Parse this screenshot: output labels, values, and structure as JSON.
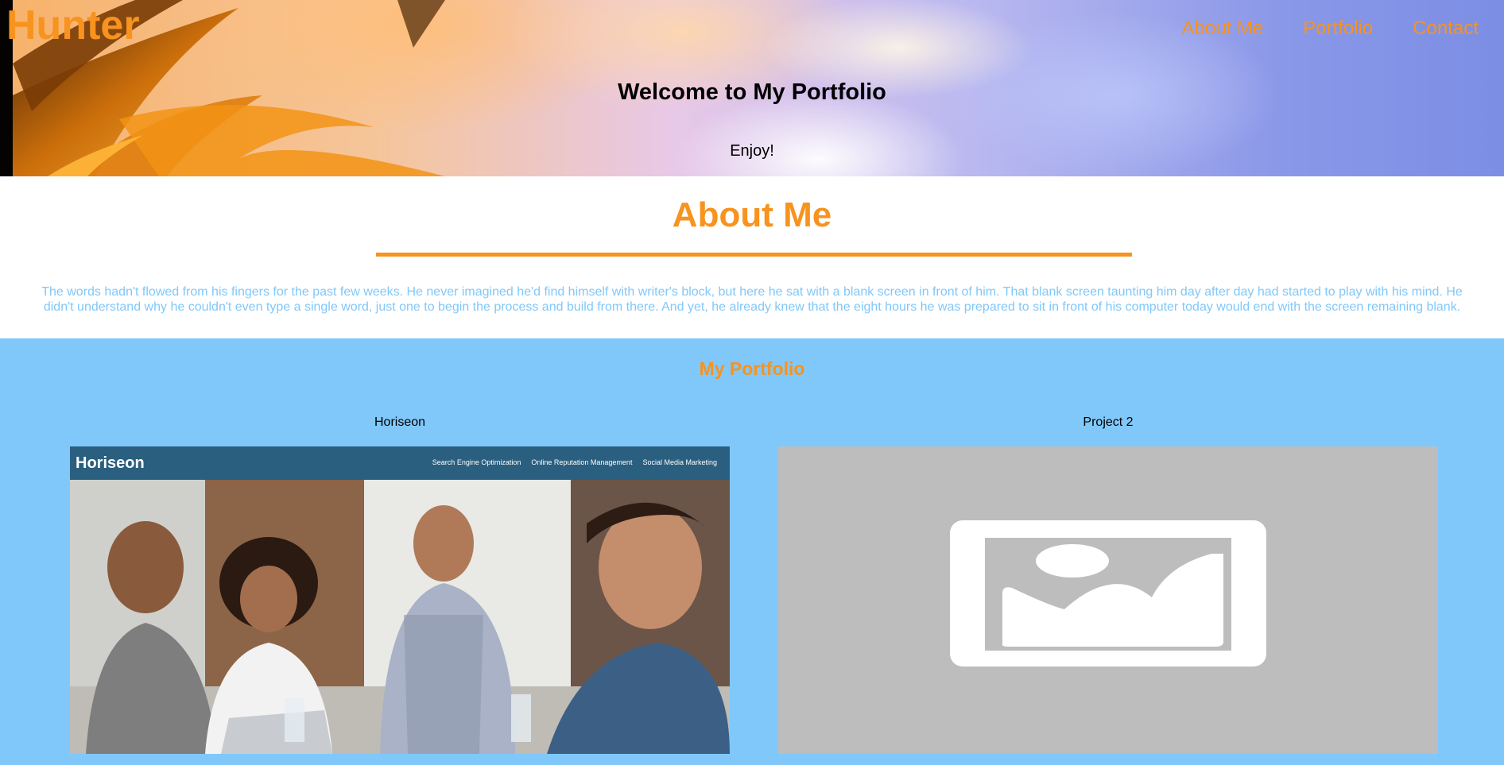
{
  "header": {
    "logo": "Hunter",
    "nav": [
      "About Me",
      "Portfolio",
      "Contact"
    ],
    "title": "Welcome to My Portfolio",
    "subtitle": "Enjoy!"
  },
  "about": {
    "heading": "About Me",
    "body": "The words hadn't flowed from his fingers for the past few weeks. He never imagined he'd find himself with writer's block, but here he sat with a blank screen in front of him. That blank screen taunting him day after day had started to play with his mind. He didn't understand why he couldn't even type a single word, just one to begin the process and build from there. And yet, he already knew that the eight hours he was prepared to sit in front of his computer today would end with the screen remaining blank."
  },
  "portfolio": {
    "heading": "My Portfolio",
    "projects": [
      {
        "title": "Horiseon",
        "thumb_brand": "Horiseon",
        "thumb_links": [
          "Search Engine Optimization",
          "Online Reputation Management",
          "Social Media Marketing"
        ]
      },
      {
        "title": "Project 2"
      }
    ]
  },
  "colors": {
    "accent": "#f7931e",
    "portfolio_bg": "#80c8fa",
    "about_text": "#80c8fa",
    "placeholder_bg": "#bcbdbc",
    "horiseon_bar": "#2a5f7f"
  },
  "icons": [
    "image-placeholder-icon"
  ]
}
